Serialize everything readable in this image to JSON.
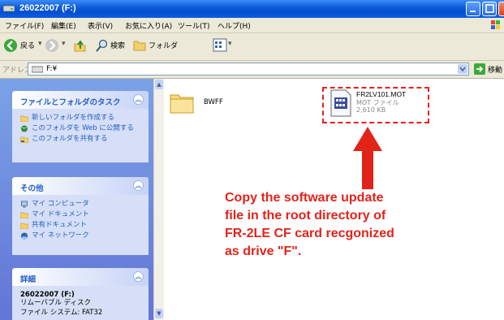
{
  "window": {
    "title": "26022007 (F:)"
  },
  "menu": [
    "ファイル(F)",
    "編集(E)",
    "表示(V)",
    "お気に入り(A)",
    "ツール(T)",
    "ヘルプ(H)"
  ],
  "toolbar": {
    "back": "戻る",
    "search": "検索",
    "folders": "フォルダ"
  },
  "address": {
    "label": "アドレス(D)",
    "value": "F:¥",
    "go": "移動"
  },
  "tasks": {
    "title": "ファイルとフォルダのタスク",
    "items": [
      "新しいフォルダを作成する",
      "このフォルダを Web に公開する",
      "このフォルダを共有する"
    ]
  },
  "other": {
    "title": "その他",
    "items": [
      "マイ コンピュータ",
      "マイ ドキュメント",
      "共有ドキュメント",
      "マイ ネットワーク"
    ]
  },
  "details": {
    "title": "詳細",
    "name": "26022007 (F:)",
    "type": "リムーバブル ディスク",
    "fs": "ファイル システム: FAT32"
  },
  "files": {
    "folder": "BWFF",
    "file_name": "FR2LV101.MOT",
    "file_type": "MOT ファイル",
    "file_size": "2,610 KB"
  },
  "callout": "Copy the software update\nfile in the root directory of\nFR-2LE CF card recgonized\nas drive \"F\".",
  "colors": {
    "accent": "#e2231a",
    "title_blue": "#0a58d8",
    "task_link": "#215dc6"
  }
}
